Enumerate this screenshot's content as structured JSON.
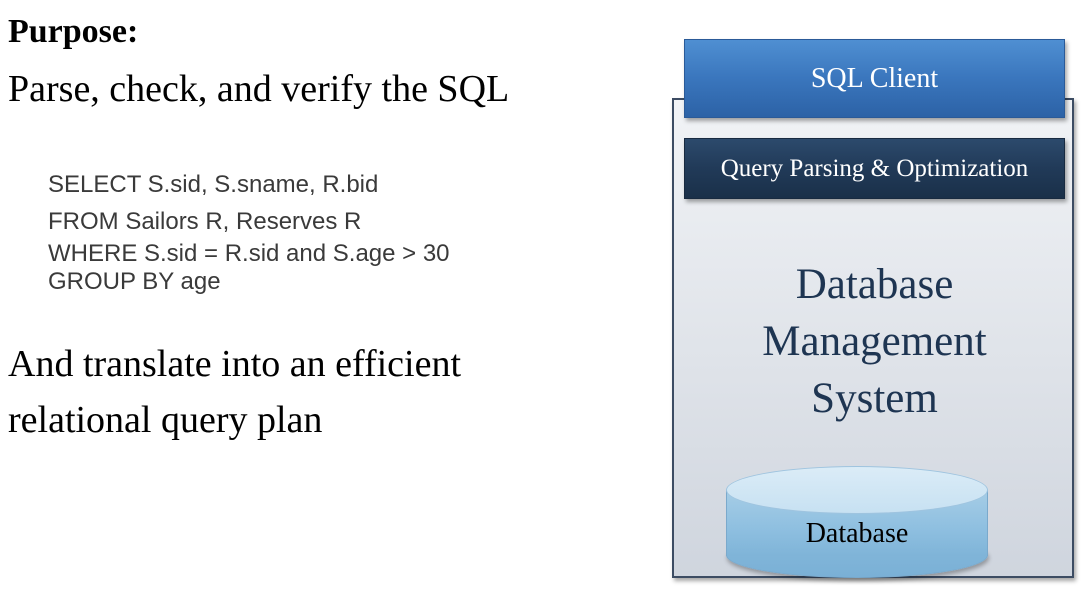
{
  "left_panel": {
    "heading": "Purpose:",
    "purpose": "Parse, check, and verify the SQL",
    "sql_lines": [
      "SELECT S.sid, S.sname, R.bid",
      "FROM Sailors R, Reserves R",
      "WHERE S.sid = R.sid and S.age > 30",
      "GROUP BY age"
    ],
    "translate_line1": "And translate into an efficient",
    "translate_line2": "relational query plan"
  },
  "diagram": {
    "client_label": "SQL Client",
    "parser_label": "Query Parsing & Optimization",
    "dbms_title_lines": [
      "Database",
      "Management",
      "System"
    ],
    "database_label": "Database"
  },
  "colors": {
    "client_fill": "#3a76bd",
    "parser_fill": "#213a58",
    "dbms_border": "#3c4c63",
    "dbms_title": "#1e3552",
    "database_fill": "#8ebfe0"
  }
}
